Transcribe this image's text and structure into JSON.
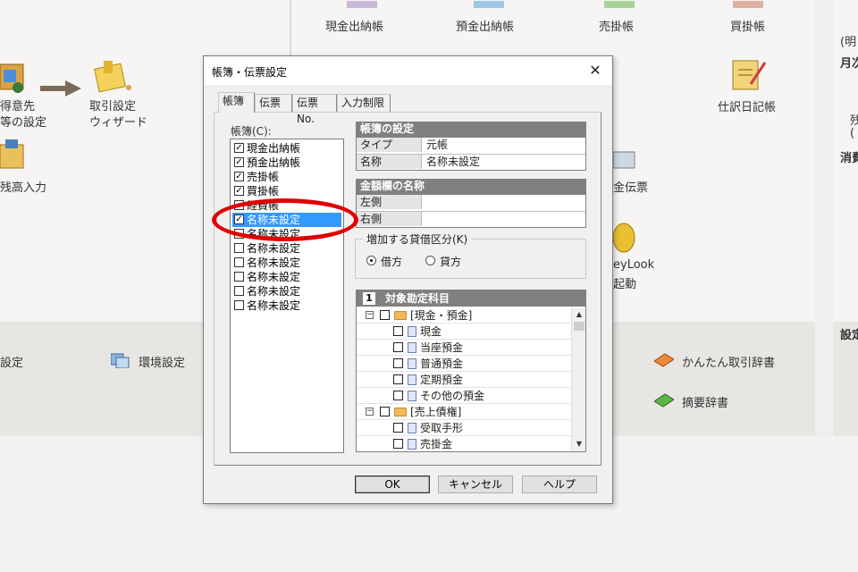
{
  "background": {
    "left_items": [
      {
        "label1": "得意先",
        "label2": "等の設定"
      },
      {
        "label1": "取引設定",
        "label2": "ウィザード"
      },
      {
        "label1": "残高入力"
      }
    ],
    "top_items": [
      "現金出納帳",
      "預金出納帳",
      "売掛帳",
      "買掛帳"
    ],
    "journal_label": "仕訳日記帳",
    "slip_label": "金伝票",
    "keylook_label1": "eyLook",
    "keylook_label2": "起動",
    "band_items": [
      "設定",
      "環境設定",
      "かんたん取引辞書",
      "摘要辞書"
    ],
    "right_edge": [
      "(明",
      "月次",
      "残",
      "(",
      "消費",
      "設定"
    ]
  },
  "dialog": {
    "title": "帳簿・伝票設定",
    "close_glyph": "✕",
    "tabs": [
      "帳簿",
      "伝票",
      "伝票No.",
      "入力制限"
    ],
    "list_label": "帳簿(C):",
    "ledger_list": [
      {
        "label": "現金出納帳",
        "checked": true
      },
      {
        "label": "預金出納帳",
        "checked": true
      },
      {
        "label": "売掛帳",
        "checked": true
      },
      {
        "label": "買掛帳",
        "checked": true
      },
      {
        "label": "経費帳",
        "checked": false
      },
      {
        "label": "名称未設定",
        "checked": true,
        "selected": true
      },
      {
        "label": "名称未設定",
        "checked": false
      },
      {
        "label": "名称未設定",
        "checked": false
      },
      {
        "label": "名称未設定",
        "checked": false
      },
      {
        "label": "名称未設定",
        "checked": false
      },
      {
        "label": "名称未設定",
        "checked": false
      },
      {
        "label": "名称未設定",
        "checked": false
      }
    ],
    "ledger_settings": {
      "header": "帳簿の設定",
      "rows": [
        {
          "key": "タイプ",
          "value": "元帳"
        },
        {
          "key": "名称",
          "value": "名称未設定"
        }
      ]
    },
    "amount_columns": {
      "header": "金額欄の名称",
      "rows": [
        {
          "key": "左側",
          "value": ""
        },
        {
          "key": "右側",
          "value": ""
        }
      ]
    },
    "increase_group": {
      "legend": "増加する貸借区分(K)",
      "options": [
        {
          "label": "借方",
          "selected": true
        },
        {
          "label": "貸方",
          "selected": false
        }
      ]
    },
    "accounts": {
      "number": "1",
      "header": "対象勘定科目",
      "rows": [
        {
          "type": "folder",
          "label": "[現金・預金]"
        },
        {
          "type": "item",
          "label": "現金"
        },
        {
          "type": "item",
          "label": "当座預金"
        },
        {
          "type": "item",
          "label": "普通預金"
        },
        {
          "type": "item",
          "label": "定期預金"
        },
        {
          "type": "item",
          "label": "その他の預金"
        },
        {
          "type": "folder",
          "label": "[売上債権]"
        },
        {
          "type": "item",
          "label": "受取手形"
        },
        {
          "type": "item",
          "label": "売掛金"
        }
      ]
    },
    "buttons": {
      "ok": "OK",
      "cancel": "キャンセル",
      "help": "ヘルプ"
    }
  },
  "colors": {
    "annotation": "#e00000",
    "selection": "#3399ff",
    "group_header": "#808080"
  }
}
